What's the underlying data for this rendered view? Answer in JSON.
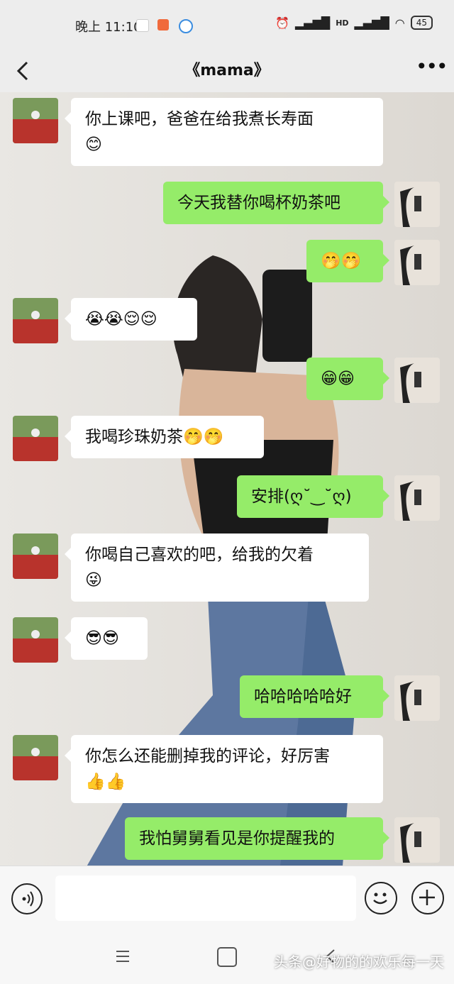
{
  "status": {
    "time": "晚上 11:10",
    "signal": "HD",
    "battery": "45"
  },
  "header": {
    "title": "《mama》"
  },
  "messages": [
    {
      "side": "left",
      "text": "你上课吧，爸爸在给我煮长寿面",
      "emojis": [
        "😊"
      ]
    },
    {
      "side": "right",
      "text": "今天我替你喝杯奶茶吧",
      "emojis": []
    },
    {
      "side": "right",
      "text": "",
      "emojis": [
        "🤭",
        "🤭"
      ]
    },
    {
      "side": "left",
      "text": "",
      "emojis": [
        "😭",
        "😭",
        "😌",
        "😌"
      ]
    },
    {
      "side": "right",
      "text": "",
      "emojis": [
        "😁",
        "😁"
      ]
    },
    {
      "side": "left",
      "text": "我喝珍珠奶茶",
      "emojis": [
        "🤭",
        "🤭"
      ]
    },
    {
      "side": "right",
      "text": "安排(ღ˘‿˘ღ)",
      "emojis": []
    },
    {
      "side": "left",
      "text": "你喝自己喜欢的吧，给我的欠着",
      "emojis": [
        "😜"
      ]
    },
    {
      "side": "left",
      "text": "",
      "emojis": [
        "😎",
        "😎"
      ]
    },
    {
      "side": "right",
      "text": "哈哈哈哈哈好",
      "emojis": []
    },
    {
      "side": "left",
      "text": "你怎么还能删掉我的评论，好厉害",
      "emojis": [
        "👍",
        "👍"
      ]
    },
    {
      "side": "right",
      "text": "我怕舅舅看见是你提醒我的",
      "emojis": []
    }
  ],
  "input": {
    "placeholder": ""
  },
  "icons": {
    "back": "chevron-left-icon",
    "more": "more-icon",
    "voice": "voice-icon",
    "emoji": "emoji-icon",
    "plus": "plus-icon"
  },
  "watermark": "头条@好物的的欢乐每一天",
  "colors": {
    "bubble_right": "#95ec69",
    "bubble_left": "#ffffff",
    "header_bg": "#ededed"
  }
}
